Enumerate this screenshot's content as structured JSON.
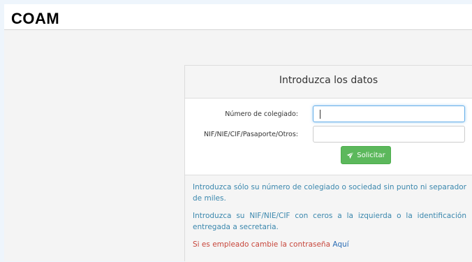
{
  "header": {
    "logo_text": "COAM"
  },
  "panel": {
    "title": "Introduzca los datos",
    "fields": {
      "colegiado_label": "Número de colegiado:",
      "colegiado_value": "",
      "nif_label": "NIF/NIE/CIF/Pasaporte/Otros:",
      "nif_value": ""
    },
    "submit_label": "Solicitar",
    "submit_icon": "paper-plane-icon",
    "notes": {
      "note1": "Introduzca sólo su número de colegiado o sociedad sin punto ni separador de miles.",
      "note2": "Introduzca su NIF/NIE/CIF con ceros a la izquierda o la identificación entregada a secretaria.",
      "note3_text": "Si es empleado cambie la contraseña",
      "note3_link": "Aquí"
    }
  },
  "colors": {
    "accent_green": "#5cb85c",
    "info_blue": "#3a87ad",
    "warning_red": "#c7463b",
    "link_blue": "#2a6db5",
    "focus_blue": "#66afe9"
  }
}
